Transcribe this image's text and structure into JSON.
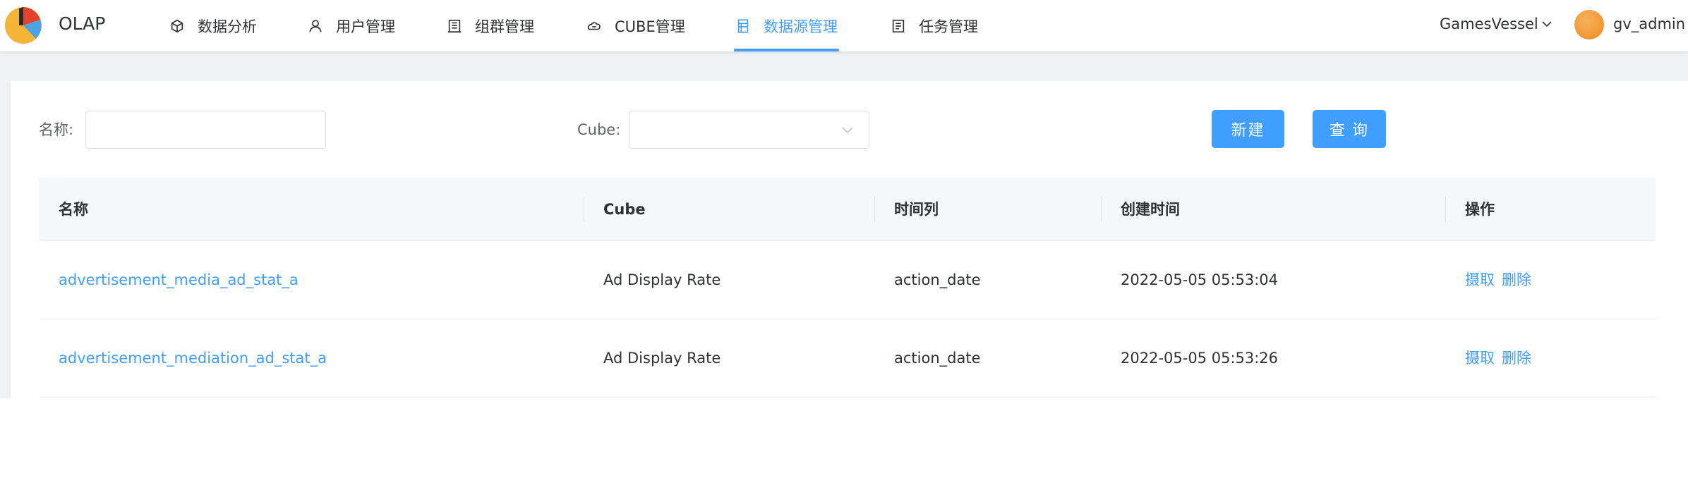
{
  "app": {
    "brand": "OLAP",
    "nav": [
      {
        "label": "数据分析",
        "icon": "cube-icon"
      },
      {
        "label": "用户管理",
        "icon": "user-icon"
      },
      {
        "label": "组群管理",
        "icon": "building-icon"
      },
      {
        "label": "CUBE管理",
        "icon": "cloud-icon"
      },
      {
        "label": "数据源管理",
        "icon": "datasource-icon",
        "active": true
      },
      {
        "label": "任务管理",
        "icon": "task-list-icon"
      }
    ],
    "workspace": "GamesVessel",
    "username": "gv_admin",
    "accent_color": "#409eff"
  },
  "filters": {
    "name_label": "名称:",
    "name_value": "",
    "cube_label": "Cube:",
    "cube_value": "",
    "new_button": "新建",
    "query_button": "查 询"
  },
  "table": {
    "columns": [
      "名称",
      "Cube",
      "时间列",
      "创建时间",
      "操作"
    ],
    "rows": [
      {
        "name": "advertisement_media_ad_stat_a",
        "cube": "Ad Display Rate",
        "time_column": "action_date",
        "created": "2022-05-05 05:53:04",
        "actions": [
          "摄取",
          "删除"
        ]
      },
      {
        "name": "advertisement_mediation_ad_stat_a",
        "cube": "Ad Display Rate",
        "time_column": "action_date",
        "created": "2022-05-05 05:53:26",
        "actions": [
          "摄取",
          "删除"
        ]
      }
    ]
  }
}
